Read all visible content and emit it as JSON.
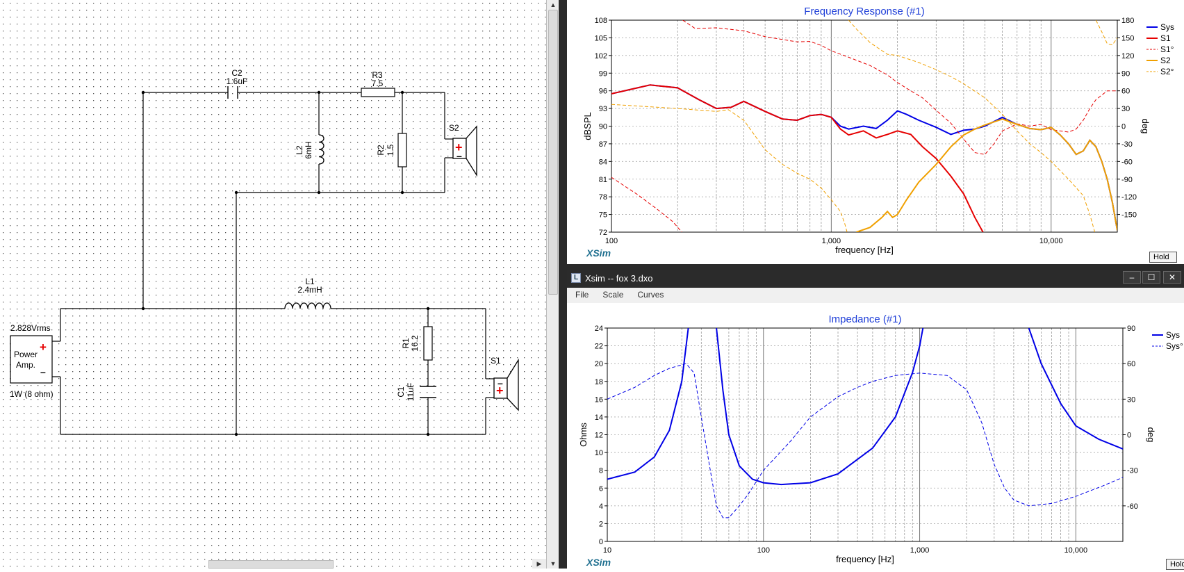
{
  "schematic": {
    "source": {
      "voltage": "2.828Vrms",
      "line1": "Power",
      "line2": "Amp.",
      "rating": "1W (8 ohm)"
    },
    "components": {
      "C2": {
        "name": "C2",
        "value": "1.6uF"
      },
      "R3": {
        "name": "R3",
        "value": "7.5"
      },
      "L2": {
        "name": "L2",
        "value": "6mH"
      },
      "R2": {
        "name": "R2",
        "value": "1.5"
      },
      "S2": {
        "name": "S2"
      },
      "L1": {
        "name": "L1",
        "value": "2.4mH"
      },
      "R1": {
        "name": "R1",
        "value": "16.2"
      },
      "C1": {
        "name": "C1",
        "value": "11uF"
      },
      "S1": {
        "name": "S1"
      }
    }
  },
  "freq_window": {
    "hold_label": "Hold",
    "logo": "XSim"
  },
  "imp_window": {
    "title": "Xsim -- fox 3.dxo",
    "menu": [
      "File",
      "Scale",
      "Curves"
    ],
    "hold_label": "Hold",
    "logo": "XSim"
  },
  "colors": {
    "sys": "#0000e6",
    "s1": "#e60000",
    "s2": "#f0a000",
    "title": "#1f3fd8",
    "logo": "#1f6f8f"
  },
  "chart_data": [
    {
      "type": "line",
      "title": "Frequency Response (#1)",
      "xlabel": "frequency [Hz]",
      "ylabel": "dBSPL",
      "y2label": "deg",
      "xscale": "log",
      "xlim": [
        100,
        20000
      ],
      "ylim": [
        72,
        108
      ],
      "y2lim": [
        -180,
        180
      ],
      "x_ticks": [
        "100",
        "1,000",
        "10,000"
      ],
      "y_ticks": [
        "72",
        "75",
        "78",
        "81",
        "84",
        "87",
        "90",
        "93",
        "96",
        "99",
        "102",
        "105",
        "108"
      ],
      "y2_ticks": [
        "-150",
        "-120",
        "-90",
        "-60",
        "-30",
        "0",
        "30",
        "60",
        "90",
        "120",
        "150",
        "180"
      ],
      "grid": true,
      "legend": "right",
      "series": [
        {
          "name": "Sys",
          "axis": "left",
          "style": "solid",
          "width": 2,
          "color": "#0000e6",
          "points": [
            [
              100,
              95.5
            ],
            [
              150,
              97
            ],
            [
              200,
              96.5
            ],
            [
              250,
              94.5
            ],
            [
              300,
              93
            ],
            [
              350,
              93.2
            ],
            [
              400,
              94.2
            ],
            [
              500,
              92.5
            ],
            [
              600,
              91.2
            ],
            [
              700,
              91
            ],
            [
              800,
              91.8
            ],
            [
              900,
              92
            ],
            [
              1000,
              91.5
            ],
            [
              1100,
              90
            ],
            [
              1200,
              89.5
            ],
            [
              1400,
              90
            ],
            [
              1600,
              89.6
            ],
            [
              1800,
              91
            ],
            [
              2000,
              92.6
            ],
            [
              2200,
              92
            ],
            [
              2500,
              91
            ],
            [
              3000,
              89.8
            ],
            [
              3500,
              88.6
            ],
            [
              4000,
              89.3
            ],
            [
              4500,
              89.5
            ],
            [
              5000,
              90
            ],
            [
              6000,
              91.5
            ],
            [
              7000,
              90.3
            ],
            [
              8000,
              89.6
            ],
            [
              9000,
              89.4
            ],
            [
              10000,
              89.8
            ],
            [
              11000,
              88.5
            ],
            [
              12000,
              87
            ],
            [
              13000,
              85.2
            ],
            [
              14000,
              85.8
            ],
            [
              15000,
              87.6
            ],
            [
              16000,
              86.5
            ],
            [
              17000,
              84
            ],
            [
              18000,
              81
            ],
            [
              19000,
              77
            ],
            [
              20000,
              72.3
            ]
          ]
        },
        {
          "name": "S1",
          "axis": "left",
          "style": "solid",
          "width": 2,
          "color": "#e60000",
          "points": [
            [
              100,
              95.5
            ],
            [
              150,
              97
            ],
            [
              200,
              96.5
            ],
            [
              250,
              94.5
            ],
            [
              300,
              93
            ],
            [
              350,
              93.2
            ],
            [
              400,
              94.2
            ],
            [
              500,
              92.5
            ],
            [
              600,
              91.2
            ],
            [
              700,
              91
            ],
            [
              800,
              91.8
            ],
            [
              900,
              92
            ],
            [
              1000,
              91.5
            ],
            [
              1100,
              89.5
            ],
            [
              1200,
              88.5
            ],
            [
              1400,
              89.2
            ],
            [
              1600,
              88
            ],
            [
              1800,
              88.6
            ],
            [
              2000,
              89.2
            ],
            [
              2300,
              88.6
            ],
            [
              2600,
              86.5
            ],
            [
              3000,
              84.5
            ],
            [
              3500,
              81.5
            ],
            [
              4000,
              78.5
            ],
            [
              4500,
              74.5
            ],
            [
              4900,
              72
            ]
          ]
        },
        {
          "name": "S1°",
          "axis": "right",
          "style": "dashed",
          "width": 1,
          "color": "#e60000",
          "points": [
            [
              100,
              -87
            ],
            [
              130,
              -115
            ],
            [
              160,
              -140
            ],
            [
              190,
              -162
            ],
            [
              209,
              -180
            ],
            [
              211,
              180
            ],
            [
              240,
              166
            ],
            [
              300,
              167
            ],
            [
              400,
              162
            ],
            [
              500,
              152
            ],
            [
              700,
              143
            ],
            [
              800,
              144
            ],
            [
              900,
              137
            ],
            [
              1000,
              128
            ],
            [
              1200,
              117
            ],
            [
              1500,
              103
            ],
            [
              1800,
              87
            ],
            [
              2000,
              74
            ],
            [
              2300,
              60
            ],
            [
              2600,
              48
            ],
            [
              3000,
              27
            ],
            [
              3500,
              5
            ],
            [
              4000,
              -22
            ],
            [
              4500,
              -45
            ],
            [
              5000,
              -48
            ],
            [
              5500,
              -30
            ],
            [
              6000,
              -8
            ],
            [
              6500,
              -2
            ],
            [
              7000,
              4
            ],
            [
              8000,
              0
            ],
            [
              9000,
              3
            ],
            [
              10000,
              -6
            ],
            [
              12000,
              -10
            ],
            [
              13000,
              -5
            ],
            [
              14000,
              10
            ],
            [
              15000,
              30
            ],
            [
              16000,
              45
            ],
            [
              18000,
              60
            ],
            [
              20000,
              60
            ]
          ]
        },
        {
          "name": "S2",
          "axis": "left",
          "style": "solid",
          "width": 2,
          "color": "#f0a000",
          "points": [
            [
              1300,
              72
            ],
            [
              1500,
              72.8
            ],
            [
              1700,
              74.5
            ],
            [
              1800,
              75.5
            ],
            [
              1900,
              74.5
            ],
            [
              2000,
              75
            ],
            [
              2200,
              77.5
            ],
            [
              2500,
              80.5
            ],
            [
              3000,
              83.5
            ],
            [
              3500,
              86.5
            ],
            [
              4000,
              88.5
            ],
            [
              4500,
              89.5
            ],
            [
              5000,
              90.2
            ],
            [
              6000,
              91.2
            ],
            [
              7000,
              90.3
            ],
            [
              8000,
              89.6
            ],
            [
              9000,
              89.4
            ],
            [
              10000,
              89.8
            ],
            [
              11000,
              88.5
            ],
            [
              12000,
              87
            ],
            [
              13000,
              85.2
            ],
            [
              14000,
              85.8
            ],
            [
              15000,
              87.6
            ],
            [
              16000,
              86.5
            ],
            [
              17000,
              84
            ],
            [
              18000,
              81
            ],
            [
              19000,
              77
            ],
            [
              20000,
              72.3
            ]
          ]
        },
        {
          "name": "S2°",
          "axis": "right",
          "style": "dashed",
          "width": 1,
          "color": "#f0a000",
          "points": [
            [
              100,
              37
            ],
            [
              200,
              30
            ],
            [
              300,
              25
            ],
            [
              340,
              28
            ],
            [
              400,
              10
            ],
            [
              500,
              -40
            ],
            [
              600,
              -65
            ],
            [
              700,
              -80
            ],
            [
              800,
              -90
            ],
            [
              900,
              -105
            ],
            [
              1000,
              -125
            ],
            [
              1100,
              -145
            ],
            [
              1150,
              -165
            ],
            [
              1180,
              -180
            ],
            [
              1200,
              180
            ],
            [
              1300,
              165
            ],
            [
              1500,
              142
            ],
            [
              1800,
              122
            ],
            [
              2000,
              120
            ],
            [
              2500,
              108
            ],
            [
              3000,
              96
            ],
            [
              3500,
              84
            ],
            [
              4000,
              72
            ],
            [
              5000,
              48
            ],
            [
              6000,
              20
            ],
            [
              7000,
              -8
            ],
            [
              8000,
              -30
            ],
            [
              9000,
              -45
            ],
            [
              10000,
              -60
            ],
            [
              12000,
              -90
            ],
            [
              14000,
              -118
            ],
            [
              15000,
              -150
            ],
            [
              15800,
              -180
            ],
            [
              16000,
              180
            ],
            [
              17000,
              160
            ],
            [
              18000,
              140
            ],
            [
              19000,
              138
            ],
            [
              20000,
              150
            ]
          ]
        }
      ]
    },
    {
      "type": "line",
      "title": "Impedance (#1)",
      "xlabel": "frequency [Hz]",
      "ylabel": "Ohms",
      "y2label": "deg",
      "xscale": "log",
      "xlim": [
        10,
        20000
      ],
      "ylim": [
        0,
        24
      ],
      "y2lim": [
        -90,
        90
      ],
      "x_ticks": [
        "10",
        "100",
        "1,000",
        "10,000"
      ],
      "y_ticks": [
        "0",
        "2",
        "4",
        "6",
        "8",
        "10",
        "12",
        "14",
        "16",
        "18",
        "20",
        "22",
        "24"
      ],
      "y2_ticks": [
        "-60",
        "-30",
        "0",
        "30",
        "60",
        "90"
      ],
      "grid": true,
      "legend": "right",
      "series": [
        {
          "name": "Sys",
          "axis": "left",
          "style": "solid",
          "width": 2,
          "color": "#0000e6",
          "points": [
            [
              10,
              7
            ],
            [
              15,
              7.8
            ],
            [
              20,
              9.5
            ],
            [
              25,
              12.5
            ],
            [
              30,
              18
            ],
            [
              33,
              24
            ]
          ],
          "points2": [
            [
              50,
              24
            ],
            [
              55,
              17
            ],
            [
              60,
              12
            ],
            [
              70,
              8.5
            ],
            [
              85,
              7
            ],
            [
              100,
              6.6
            ],
            [
              130,
              6.4
            ],
            [
              200,
              6.6
            ],
            [
              300,
              7.6
            ],
            [
              500,
              10.5
            ],
            [
              700,
              14
            ],
            [
              900,
              19
            ],
            [
              1000,
              22
            ],
            [
              1050,
              24
            ]
          ],
          "points3": [
            [
              5000,
              24
            ],
            [
              6000,
              20
            ],
            [
              8000,
              15.5
            ],
            [
              10000,
              13
            ],
            [
              14000,
              11.5
            ],
            [
              20000,
              10.4
            ]
          ]
        },
        {
          "name": "Sys°",
          "axis": "right",
          "style": "dashed",
          "width": 1,
          "color": "#0000e6",
          "points": [
            [
              10,
              30
            ],
            [
              15,
              40
            ],
            [
              20,
              50
            ],
            [
              25,
              56
            ],
            [
              32,
              60
            ],
            [
              36,
              52
            ],
            [
              40,
              15
            ],
            [
              45,
              -25
            ],
            [
              50,
              -60
            ],
            [
              55,
              -70
            ],
            [
              60,
              -70
            ],
            [
              70,
              -60
            ],
            [
              80,
              -50
            ],
            [
              100,
              -30
            ],
            [
              150,
              -5
            ],
            [
              200,
              15
            ],
            [
              300,
              32
            ],
            [
              400,
              40
            ],
            [
              500,
              45
            ],
            [
              700,
              50
            ],
            [
              1000,
              52
            ],
            [
              1500,
              50
            ],
            [
              2000,
              38
            ],
            [
              2500,
              10
            ],
            [
              3000,
              -25
            ],
            [
              3500,
              -45
            ],
            [
              4000,
              -55
            ],
            [
              5000,
              -60
            ],
            [
              7000,
              -58
            ],
            [
              10000,
              -52
            ],
            [
              15000,
              -43
            ],
            [
              20000,
              -36
            ]
          ]
        }
      ]
    }
  ]
}
